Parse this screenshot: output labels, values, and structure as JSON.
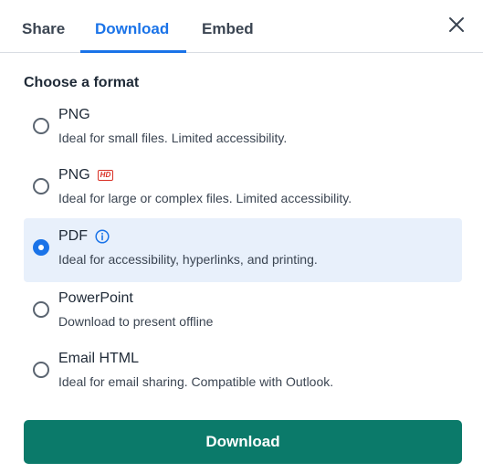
{
  "tabs": [
    {
      "label": "Share"
    },
    {
      "label": "Download"
    },
    {
      "label": "Embed"
    }
  ],
  "active_tab": "Download",
  "heading": "Choose a format",
  "options": [
    {
      "title": "PNG",
      "description": "Ideal for small files. Limited accessibility.",
      "badge": "",
      "selected": false
    },
    {
      "title": "PNG",
      "description": "Ideal for large or complex files. Limited accessibility.",
      "badge": "HD",
      "selected": false
    },
    {
      "title": "PDF",
      "description": "Ideal for accessibility, hyperlinks, and printing.",
      "badge": "info-icon",
      "selected": true
    },
    {
      "title": "PowerPoint",
      "description": "Download to present offline",
      "badge": "",
      "selected": false
    },
    {
      "title": "Email HTML",
      "description": "Ideal for email sharing. Compatible with Outlook.",
      "badge": "",
      "selected": false
    }
  ],
  "download_label": "Download",
  "colors": {
    "accent": "#1a73e8",
    "primary_button": "#0b7a6a",
    "selected_bg": "#e8f0fb",
    "hd_badge": "#d93025"
  },
  "icons": {
    "close": "close-icon",
    "info": "info-icon",
    "hd": "hd-badge-icon"
  }
}
